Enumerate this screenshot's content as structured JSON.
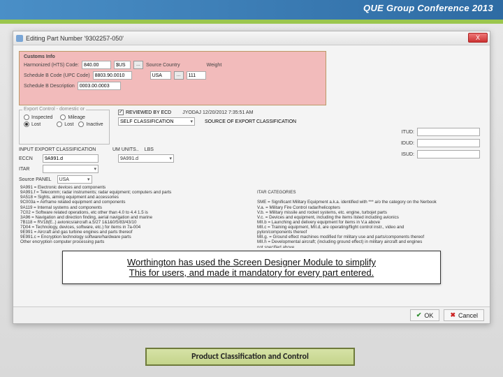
{
  "banner": {
    "title": "QUE Group Conference 2013"
  },
  "window": {
    "title": "Editing Part Number '9302257-050'",
    "close": "X"
  },
  "customs": {
    "heading": "Customs Info",
    "hts_label": "Harmonized (HTS) Code:",
    "hts_val": "840.00",
    "hts_unit": "$US",
    "src_country_label": "Source Country",
    "weight_label": "Weight",
    "sched_label": "Schedule B Code (UPC Code)",
    "sched_val": "8803.90.0010",
    "sched_country": "USA",
    "sched_extra": "111",
    "sitc_label": "Schedule B Description",
    "sitc_val": "0003.00.0003"
  },
  "ecd": {
    "group_label": "Export Control - domestic or",
    "inspected": "Inspected",
    "mileage": "Mileage",
    "lost": "Lost",
    "lost2": "Lost",
    "inactive": "Inactive",
    "reviewed_label": "REVIEWED BY ECD",
    "reviewed_stamp": "JYODAJ 12/20/2012 7:35:51 AM",
    "self_class": "SELF CLASSIFICATION",
    "src_export_label": "SOURCE OF EXPORT CLASSIFICATION"
  },
  "export": {
    "title": "INPUT EXPORT CLASSIFICATION",
    "units_label": "UM UNITS..",
    "units_val": "LBS",
    "eccn_label": "ECCN",
    "eccn_val1": "9A991.d",
    "eccn_val2": "9A991.d",
    "itar_label": "ITAR",
    "source_label": "Source PANEL",
    "source_val": "USA"
  },
  "right": {
    "f1": "ITUD:",
    "f2": "IDUD:",
    "f3": "ISUD:"
  },
  "categories": {
    "left": "9A991 = Electronic devices and components\n9A991.f = Telecomm; radar instruments; radar equipment; computers and parts\n9A518 = Sights, aiming equipment and accessories\n9C003a = Airframe related equipment and components\n9A119 = Internal systems and components\n7C02 = Software related operations, etc other than 4.0 to 4.4 1.5 is\n3A96 = Navigation and direction finding, aerial navigation and marine\n7B118 = RV18(E..) avionics/aircraft a.5/27 1&1&0/5/83/43/10\n7D04 = Technology, devices, software, etc.) for items in 7a-004\n9E991 = Aircraft and gas turbine engines and parts thereof\n9E991.c = Encryption technology software/hardware parts\nOther encryption computer processing parts",
    "rightTitle": "ITAR CATEGORIES",
    "right": "SME = Significant Military Equipment a.k.a. identified with *** a/o the category on the Nerbook\nV.a. = Military Fire Control radar/helicopters\nV.b. = Military missile and rocket systems, etc. engine, turbojet parts\nV.c. = Devices and equipment, including the items listed including avionics\nMII.b = Launching and delivery equipment for items in V.a above\nMII.c = Training equipment, MII.d, are operating/flight control instr., video and\npylon/components thereof\nMII.g. = Ground effect machines modified for military use and parts/components thereof\nMII.h = Developmental aircraft; (including ground effect) in military aircraft and engines\nnot specified above\nXI.a. = Tracking device/ radar systems\nXII.i = Fire control device and components"
  },
  "note": {
    "line1": "Worthington has used the Screen Designer Module to simplify",
    "line2": "This for users, and made it mandatory for every part entered."
  },
  "footer": {
    "ok": "OK",
    "cancel": "Cancel"
  },
  "caption": "Product Classification and Control"
}
